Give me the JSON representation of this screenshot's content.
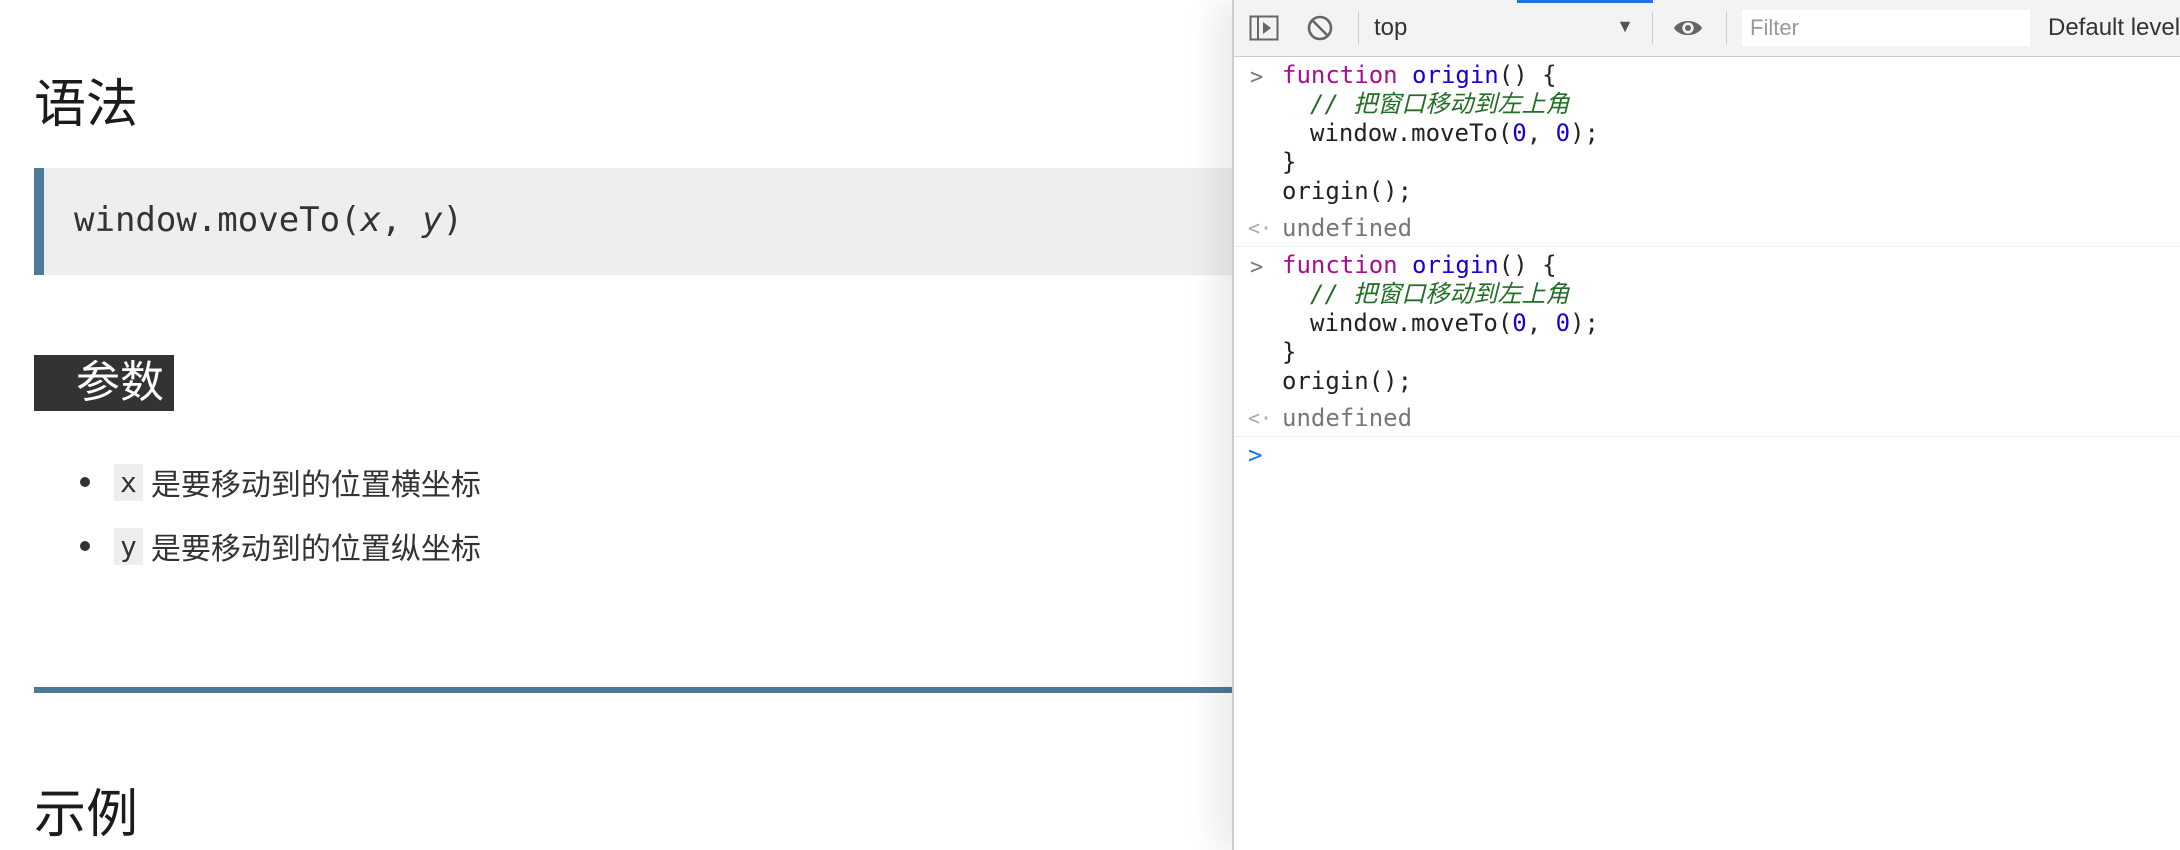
{
  "doc": {
    "syntax_heading": "语法",
    "syntax_prefix": "window.moveTo(",
    "syntax_arg_x": "x",
    "syntax_sep": ", ",
    "syntax_arg_y": "y",
    "syntax_suffix": ")",
    "params_heading": "参数",
    "params": [
      {
        "code": "x",
        "text": "是要移动到的位置横坐标"
      },
      {
        "code": "y",
        "text": "是要移动到的位置纵坐标"
      }
    ],
    "example_heading": "示例"
  },
  "devtools": {
    "context": "top",
    "filter_placeholder": "Filter",
    "levels_label": "Default levels",
    "icons": [
      "sidebar-toggle-icon",
      "clear-console-icon",
      "chevron-down-icon",
      "eye-icon"
    ],
    "colors": {
      "accent": "#1a73e8",
      "keyword": "#aa0d91",
      "comment": "#236e25",
      "number": "#1c00cf"
    },
    "entries": [
      {
        "code": {
          "l1_kw": "function",
          "l1_name": "origin",
          "l1_rest": "() {",
          "l2_comment": "// 把窗口移动到左上角",
          "l3_pre": "window.moveTo(",
          "l3_a": "0",
          "l3_sep": ", ",
          "l3_b": "0",
          "l3_post": ");",
          "l4": "}",
          "l5": "origin();"
        },
        "result": "undefined"
      },
      {
        "code": {
          "l1_kw": "function",
          "l1_name": "origin",
          "l1_rest": "() {",
          "l2_comment": "// 把窗口移动到左上角",
          "l3_pre": "window.moveTo(",
          "l3_a": "0",
          "l3_sep": ", ",
          "l3_b": "0",
          "l3_post": ");",
          "l4": "}",
          "l5": "origin();"
        },
        "result": "undefined"
      }
    ],
    "prompt_symbol": ">",
    "result_symbol": "<·"
  }
}
